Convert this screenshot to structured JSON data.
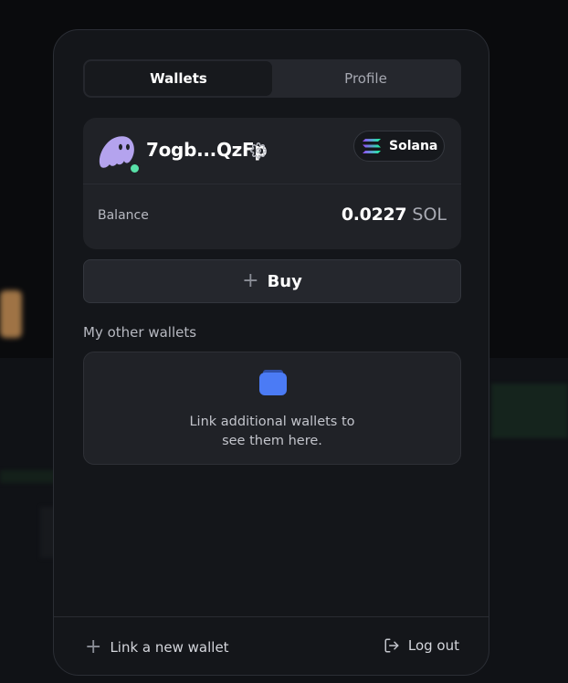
{
  "tabs": [
    {
      "label": "Wallets",
      "active": true
    },
    {
      "label": "Profile",
      "active": false
    }
  ],
  "wallet": {
    "address": "7ogb...QzFp",
    "chain": "Solana",
    "balance_label": "Balance",
    "balance_amount": "0.0227",
    "balance_unit": "SOL",
    "status": "online",
    "avatar_icon": "ghost-avatar",
    "status_color": "#58e1a8"
  },
  "buy": {
    "label": "Buy",
    "icon": "plus-icon"
  },
  "other_wallets": {
    "title": "My other wallets",
    "empty_text_line1": "Link additional wallets to",
    "empty_text_line2": "see them here.",
    "icon": "wallet-icon",
    "icon_color": "#4b7bf5"
  },
  "footer": {
    "link_new_label": "Link a new wallet",
    "logout_label": "Log out"
  },
  "colors": {
    "panel_bg": "#14161a",
    "card_bg": "#202227",
    "accent_avatar": "#b4a3ee"
  }
}
